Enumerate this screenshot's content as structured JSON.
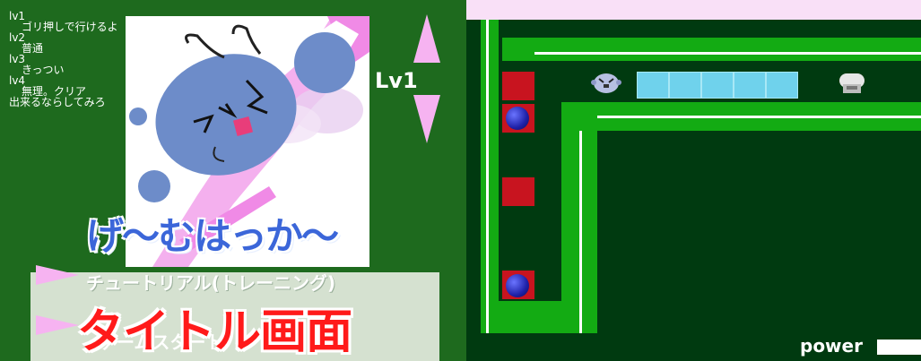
{
  "title_screen": {
    "difficulty_notes": [
      {
        "level": "lv1",
        "desc": "ゴリ押しで行けるよ"
      },
      {
        "level": "lv2",
        "desc": "普通"
      },
      {
        "level": "lv3",
        "desc": "きっつい"
      },
      {
        "level": "lv4",
        "desc": "無理。クリア"
      }
    ],
    "extra_note": "出来るならしてみろ",
    "level_selector": {
      "label": "Lv1",
      "up_icon": "triangle-up-icon",
      "down_icon": "triangle-down-icon"
    },
    "game_title": "げ〜むはっか〜",
    "menu": {
      "option_tutorial": "チュートリアル(トレーニング)",
      "option_second": "ゲームスタート"
    },
    "caption": "タイトル画面",
    "colors": {
      "background": "#1e6a1e",
      "caption": "#ff1a1a",
      "title": "#3b66d9"
    }
  },
  "game_screen": {
    "power_label": "power",
    "colors": {
      "background": "#003a10",
      "wall": "#13ab13",
      "block": "#c8141f",
      "ice": "#6fd2ec"
    }
  },
  "page": {
    "background": "#f9e0f7"
  }
}
